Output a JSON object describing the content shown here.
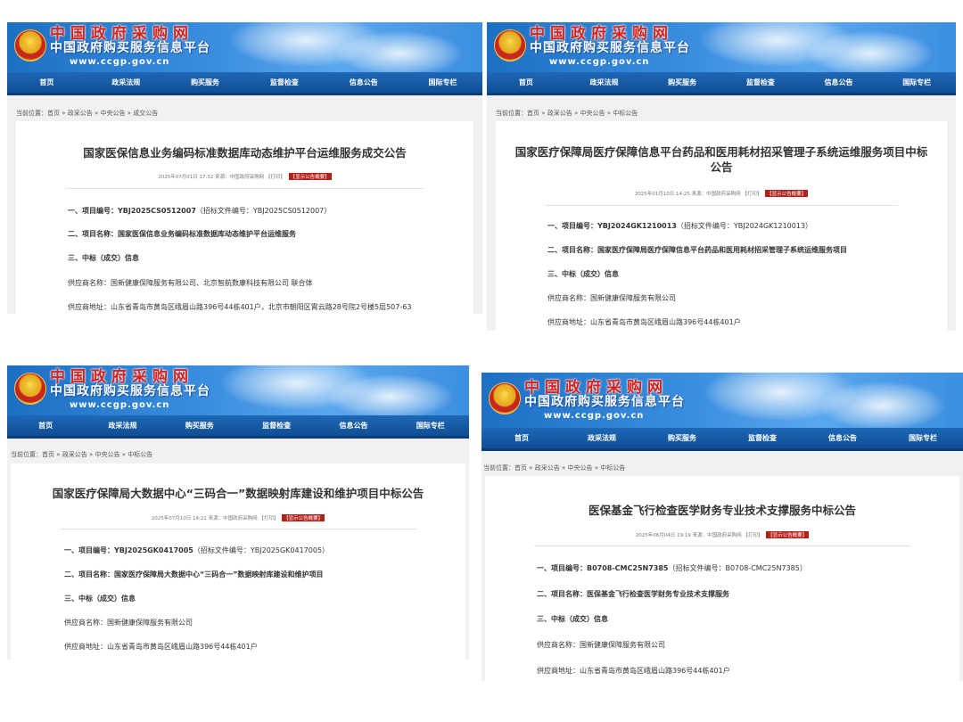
{
  "site": {
    "logo_main": "中国政府采购网",
    "logo_sub": "中国政府购买服务信息平台",
    "url": "www.ccgp.gov.cn",
    "nav": [
      "首页",
      "政采法规",
      "购买服务",
      "监督检查",
      "信息公告",
      "国际专栏"
    ],
    "colors": {
      "banner": "#3c8fe0",
      "nav": "#175ca6",
      "badge": "#b3211a"
    }
  },
  "labels": {
    "item_no": "一、项目编号：",
    "item_name": "二、项目名称：",
    "winner": "三、中标（成交）信息",
    "supplier_name": "供应商名称：",
    "supplier_addr": "供应商地址：",
    "print": "【打印】",
    "summary": "【显示公告概要】"
  },
  "notices": [
    {
      "crumb": "当前位置：首页 » 政采公告 » 中央公告 » 成交公告",
      "title": "国家医保信息业务编码标准数据库动态维护平台运维服务成交公告",
      "meta": "2025年07月01日 17:32 来源：中国政府采购网",
      "project_no": "YBJ2025CS0512007",
      "bid_doc_no": "（招标文件编号：YBJ2025CS0512007）",
      "project_name": "国家医保信息业务编码标准数据库动态维护平台运维服务",
      "supplier": "国新健康保障服务有限公司、北京智航数康科技有限公司 联合体",
      "address": "山东省青岛市黄岛区峨眉山路396号44栋401户，北京市朝阳区霄云路28号院2号楼5层507-63"
    },
    {
      "crumb": "当前位置：首页 » 政采公告 » 中央公告 » 中标公告",
      "title": "国家医疗保障局医疗保障信息平台药品和医用耗材招采管理子系统运维服务项目中标公告",
      "meta": "2025年01月10日 14:25 来源：中国政府采购网",
      "project_no": "YBJ2024GK1210013",
      "bid_doc_no": "（招标文件编号：YBJ2024GK1210013）",
      "project_name": "国家医疗保障局医疗保障信息平台药品和医用耗材招采管理子系统运维服务项目",
      "supplier": "国新健康保障服务有限公司",
      "address": "山东省青岛市黄岛区峨眉山路396号44栋401户"
    },
    {
      "crumb": "当前位置：首页 » 政采公告 » 中央公告 » 中标公告",
      "title": "国家医疗保障局大数据中心“三码合一”数据映射库建设和维护项目中标公告",
      "meta": "2025年07月10日 14:21 来源：中国政府采购网",
      "project_no": "YBJ2025GK0417005",
      "bid_doc_no": "（招标文件编号：YBJ2025GK0417005）",
      "project_name": "国家医疗保障局大数据中心“三码合一”数据映射库建设和维护项目",
      "supplier": "国新健康保障服务有限公司",
      "address": "山东省青岛市黄岛区峨眉山路396号44栋401户"
    },
    {
      "crumb": "当前位置：首页 » 政采公告 » 中央公告 » 中标公告",
      "title": "医保基金飞行检查医学财务专业技术支撑服务中标公告",
      "meta": "2025年06月04日 19:19 来源：中国政府采购网",
      "project_no": "B0708-CMC25N7385",
      "bid_doc_no": "（招标文件编号：B0708-CMC25N7385）",
      "project_name": "医保基金飞行检查医学财务专业技术支撑服务",
      "supplier": "国新健康保障服务有限公司",
      "address": "山东省青岛市黄岛区峨眉山路396号44栋401户"
    }
  ]
}
